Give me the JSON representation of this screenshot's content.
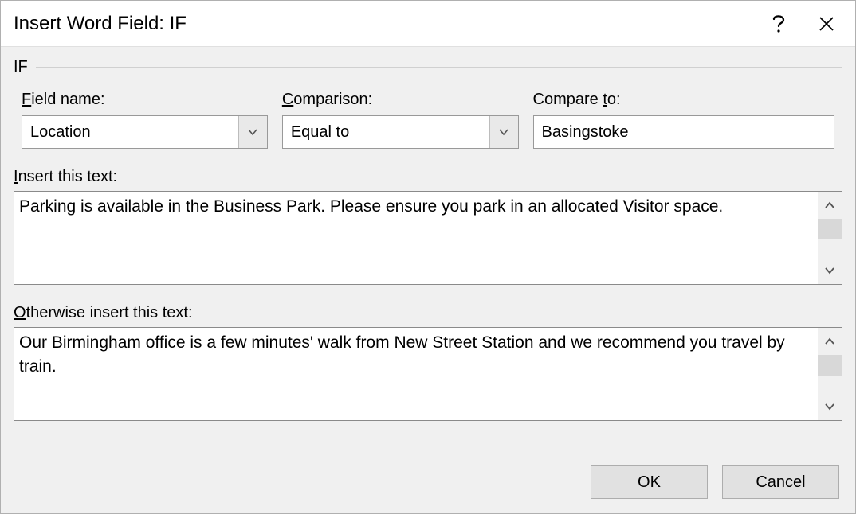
{
  "title": "Insert Word Field: IF",
  "group_label": "IF",
  "fields": {
    "field_name_label": "Field name:",
    "field_name_value": "Location",
    "comparison_label": "Comparison:",
    "comparison_value": "Equal to",
    "compare_to_label": "Compare to:",
    "compare_to_value": "Basingstoke"
  },
  "insert_label": "Insert this text:",
  "insert_text": "Parking is available in the Business Park.  Please ensure you park in an allocated Visitor space.",
  "otherwise_label": "Otherwise insert this text:",
  "otherwise_text": "Our Birmingham office is a few minutes' walk from New Street Station and we recommend you travel by train.",
  "buttons": {
    "ok": "OK",
    "cancel": "Cancel"
  }
}
